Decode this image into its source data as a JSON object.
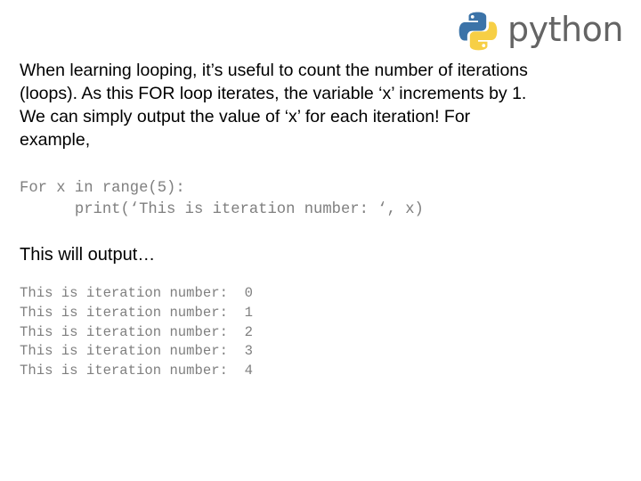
{
  "logo": {
    "icon": "python-logo-icon",
    "wordmark": "python",
    "colors": {
      "blue": "#3b73a8",
      "yellow": "#f7cf45",
      "text": "#646464"
    }
  },
  "intro": {
    "lines": [
      "When learning looping, it’s useful to count the number of iterations",
      "(loops). As this FOR loop iterates, the variable ‘x’ increments by 1.",
      "We can simply output the value of ‘x’ for each iteration!  For",
      "example,"
    ]
  },
  "code": {
    "lines": [
      "For x in range(5):",
      "      print(‘This is iteration number: ‘, x)"
    ]
  },
  "output_label": "This will output…",
  "output": {
    "prefix": "This is iteration number:",
    "values": [
      "0",
      "1",
      "2",
      "3",
      "4"
    ]
  }
}
